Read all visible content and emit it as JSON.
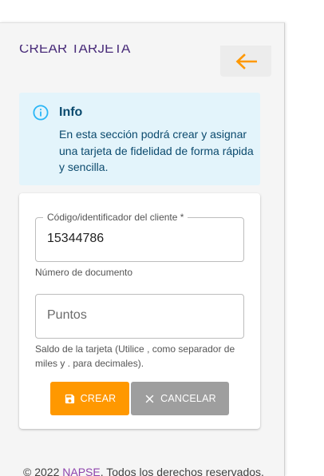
{
  "page": {
    "title": "Crear tarjeta",
    "back_icon": "arrow-left-icon"
  },
  "info": {
    "icon": "info-circle-icon",
    "title": "Info",
    "text": "En esta sección podrá crear y asignar una tarjeta de fidelidad de forma rápida y sencilla."
  },
  "form": {
    "customer_field": {
      "label": "Código/identificador del cliente *",
      "value": "15344786",
      "helper": "Número de documento"
    },
    "points_field": {
      "placeholder": "Puntos",
      "value": "",
      "helper": "Saldo de la tarjeta (Utilice , como separador de miles y . para decimales)."
    },
    "create_button": {
      "label": "Crear",
      "icon": "save-icon"
    },
    "cancel_button": {
      "label": "Cancelar",
      "icon": "close-icon"
    }
  },
  "footer": {
    "prefix": "© 2022 ",
    "brand": "NAPSE",
    "suffix": ". Todos los derechos reservados."
  },
  "colors": {
    "accent": "#ff9800",
    "title": "#4a2d7a",
    "info_bg": "#e3f4fb",
    "info_text": "#0b4a6e",
    "info_icon": "#29b6f6",
    "brand": "#8e44ad",
    "cancel": "#9e9e9e"
  }
}
